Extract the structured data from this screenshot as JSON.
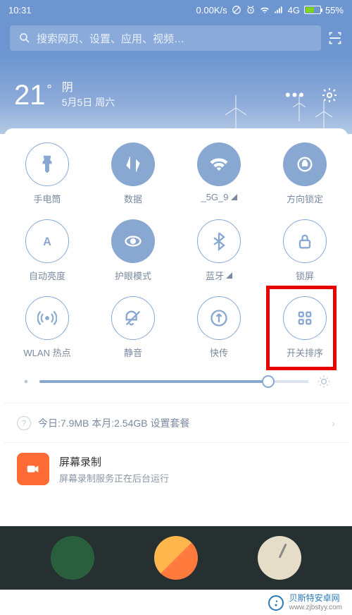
{
  "status": {
    "time": "10:31",
    "speed": "0.00K/s",
    "network": "4G",
    "battery_pct": "55%"
  },
  "search": {
    "placeholder": "搜索网页、设置、应用、视频…"
  },
  "weather": {
    "temp": "21",
    "degree": "°",
    "condition": "阴",
    "date": "5月5日 周六"
  },
  "toggles": [
    {
      "label": "手电筒",
      "icon": "flashlight",
      "on": false
    },
    {
      "label": "数据",
      "icon": "data-swap",
      "on": true
    },
    {
      "label": "_5G_9",
      "icon": "wifi",
      "on": true,
      "signal": true
    },
    {
      "label": "方向锁定",
      "icon": "orientation-lock",
      "on": true
    },
    {
      "label": "自动亮度",
      "icon": "auto-brightness",
      "on": false
    },
    {
      "label": "护眼模式",
      "icon": "eye-mode",
      "on": true
    },
    {
      "label": "蓝牙",
      "icon": "bluetooth",
      "on": false,
      "signal": true
    },
    {
      "label": "锁屏",
      "icon": "lock",
      "on": false
    },
    {
      "label": "WLAN 热点",
      "icon": "hotspot",
      "on": false
    },
    {
      "label": "静音",
      "icon": "mute",
      "on": false
    },
    {
      "label": "快传",
      "icon": "quick-transfer",
      "on": false
    },
    {
      "label": "开关排序",
      "icon": "grid-sort",
      "on": false
    }
  ],
  "data_usage": {
    "text": "今日:7.9MB  本月:2.54GB  设置套餐"
  },
  "notification": {
    "title": "屏幕录制",
    "subtitle": "屏幕录制服务正在后台运行"
  },
  "watermark": {
    "name": "贝斯特安卓网",
    "url": "www.zjbstyy.com"
  }
}
